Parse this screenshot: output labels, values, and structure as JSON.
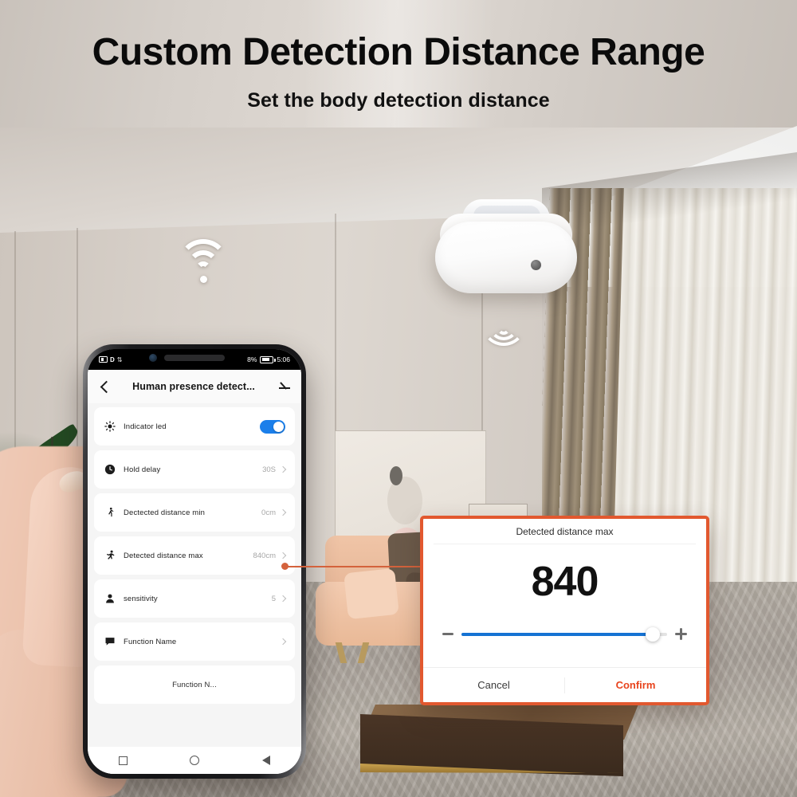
{
  "heading": {
    "title": "Custom Detection Distance Range",
    "subtitle": "Set the body detection distance"
  },
  "phone": {
    "status_bar": {
      "left_badge": "D",
      "battery_percent": "8%",
      "time": "5:06"
    },
    "app_header": {
      "back_icon": "chevron-left-icon",
      "title": "Human presence detect...",
      "edit_icon": "pencil-edit-icon"
    },
    "rows": [
      {
        "icon": "brightness-sun-icon",
        "label": "Indicator led",
        "value": "",
        "control": "toggle",
        "toggle_on": true
      },
      {
        "icon": "clock-icon",
        "label": "Hold delay",
        "value": "30S",
        "control": "chevron"
      },
      {
        "icon": "walking-person-icon",
        "label": "Dectected distance min",
        "value": "0cm",
        "control": "chevron"
      },
      {
        "icon": "running-person-icon",
        "label": "Detected distance max",
        "value": "840cm",
        "control": "chevron"
      },
      {
        "icon": "user-person-icon",
        "label": "sensitivity",
        "value": "5",
        "control": "chevron"
      },
      {
        "icon": "chat-bubble-icon",
        "label": "Function Name",
        "value": "",
        "control": "chevron"
      }
    ],
    "footer_row": {
      "label": "Function N..."
    },
    "nav_bar": {
      "recents": "square-recents-icon",
      "home": "circle-home-icon",
      "back": "triangle-back-icon"
    }
  },
  "dialog": {
    "title": "Detected distance max",
    "value": "840",
    "slider": {
      "percent": 93,
      "minus_label": "decrease",
      "plus_label": "increase"
    },
    "cancel_label": "Cancel",
    "confirm_label": "Confirm",
    "border_color": "#e2582f",
    "confirm_color": "#e8441d",
    "slider_color": "#1572d3"
  },
  "scene": {
    "device": "ceiling-presence-sensor",
    "wifi_icon": "wifi-signal-icon",
    "wave_icon": "sensor-wave-icon"
  }
}
